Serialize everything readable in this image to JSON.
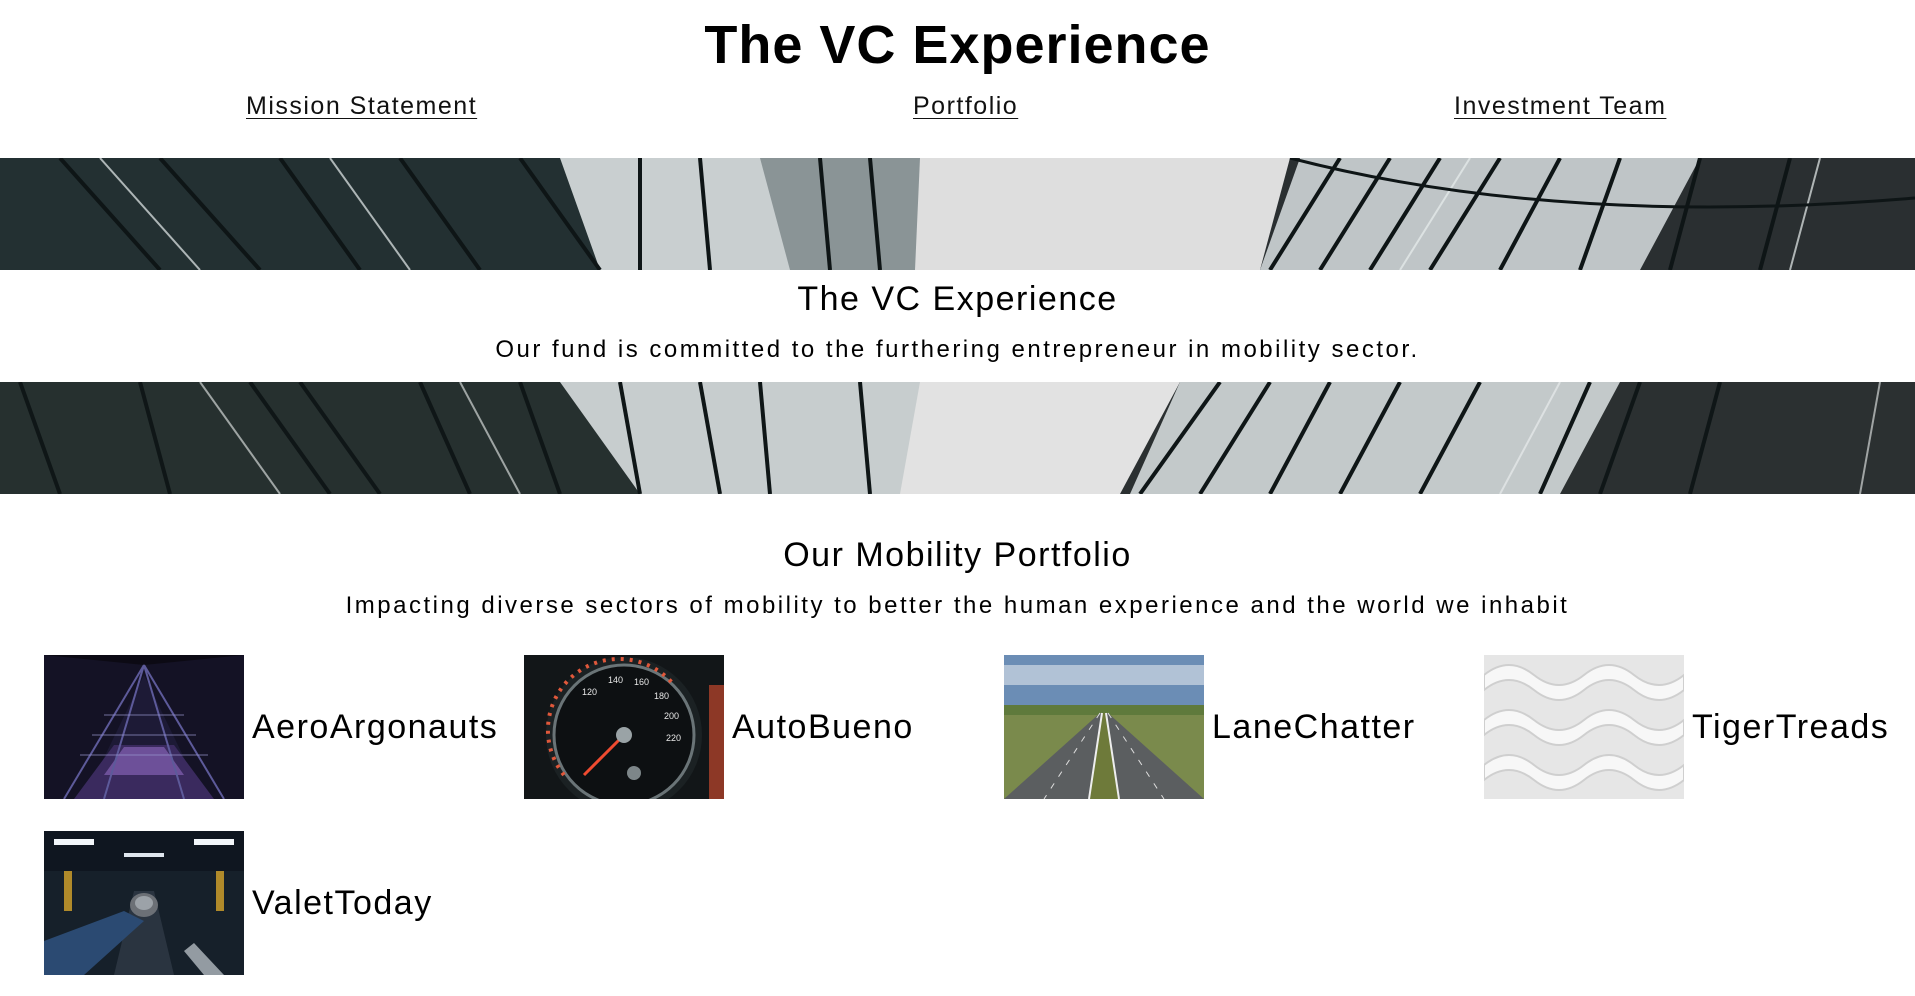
{
  "site": {
    "title": "The VC Experience"
  },
  "nav": {
    "mission": "Mission Statement",
    "portfolio": "Portfolio",
    "team": "Investment Team"
  },
  "hero": {
    "heading": "The VC Experience",
    "subtitle": "Our fund is committed to the furthering entrepreneur in mobility sector."
  },
  "portfolio": {
    "heading": "Our Mobility Portfolio",
    "subtitle": "Impacting diverse sectors of mobility to better the human experience and the world we inhabit",
    "companies": [
      {
        "name": "AeroArgonauts",
        "image": "purple-tunnel-corridor"
      },
      {
        "name": "AutoBueno",
        "image": "car-speedometer"
      },
      {
        "name": "LaneChatter",
        "image": "empty-highway"
      },
      {
        "name": "TigerTreads",
        "image": "white-3d-pattern"
      },
      {
        "name": "ValetToday",
        "image": "hand-holding-car-key-in-garage"
      }
    ]
  },
  "colors": {
    "text": "#000000",
    "background": "#ffffff",
    "sky": "#dcdcdc",
    "glass_dark": "#1f2a2b"
  }
}
